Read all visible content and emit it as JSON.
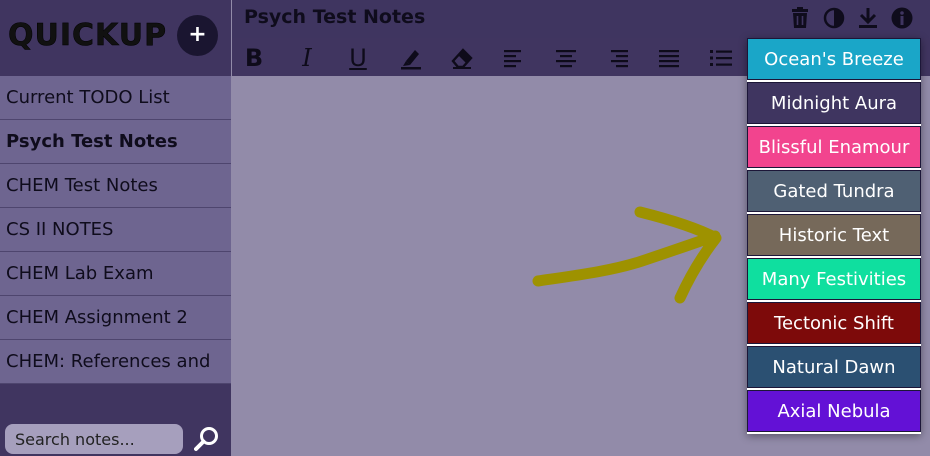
{
  "app": {
    "logo_text": "QUICKUP",
    "add_label": "+"
  },
  "sidebar": {
    "notes": [
      {
        "label": "Current TODO List",
        "active": false
      },
      {
        "label": "Psych Test Notes",
        "active": true
      },
      {
        "label": "CHEM Test Notes",
        "active": false
      },
      {
        "label": "CS II NOTES",
        "active": false
      },
      {
        "label": "CHEM Lab Exam",
        "active": false
      },
      {
        "label": "CHEM Assignment 2",
        "active": false
      },
      {
        "label": "CHEM: References and",
        "active": false
      }
    ],
    "search_placeholder": "Search notes..."
  },
  "header": {
    "title": "Psych Test Notes",
    "icons": [
      "trash-icon",
      "theme-icon",
      "download-icon",
      "info-icon"
    ]
  },
  "toolbar": {
    "bold": "B",
    "italic": "I",
    "underline": "U",
    "icons": [
      "highlighter-icon",
      "eraser-icon",
      "align-left-icon",
      "align-center-icon",
      "align-right-icon",
      "align-justify-icon",
      "list-icon"
    ]
  },
  "theme_menu": {
    "items": [
      {
        "label": "Ocean's Breeze",
        "color": "#1aa6c8",
        "text_color": "#ffffff"
      },
      {
        "label": "Midnight Aura",
        "color": "#3f3560",
        "text_color": "#ffffff"
      },
      {
        "label": "Blissful Enamour",
        "color": "#f2448e",
        "text_color": "#ffffff"
      },
      {
        "label": "Gated Tundra",
        "color": "#4f6073",
        "text_color": "#ffffff"
      },
      {
        "label": "Historic Text",
        "color": "#76695a",
        "text_color": "#ffffff"
      },
      {
        "label": "Many Festivities",
        "color": "#0fdf9f",
        "text_color": "#ffffff"
      },
      {
        "label": "Tectonic Shift",
        "color": "#7d0a0a",
        "text_color": "#ffffff"
      },
      {
        "label": "Natural Dawn",
        "color": "#2b5072",
        "text_color": "#ffffff"
      },
      {
        "label": "Axial Nebula",
        "color": "#6311d6",
        "text_color": "#ffffff"
      }
    ]
  },
  "annotation": {
    "arrow_color": "#9e9200"
  }
}
